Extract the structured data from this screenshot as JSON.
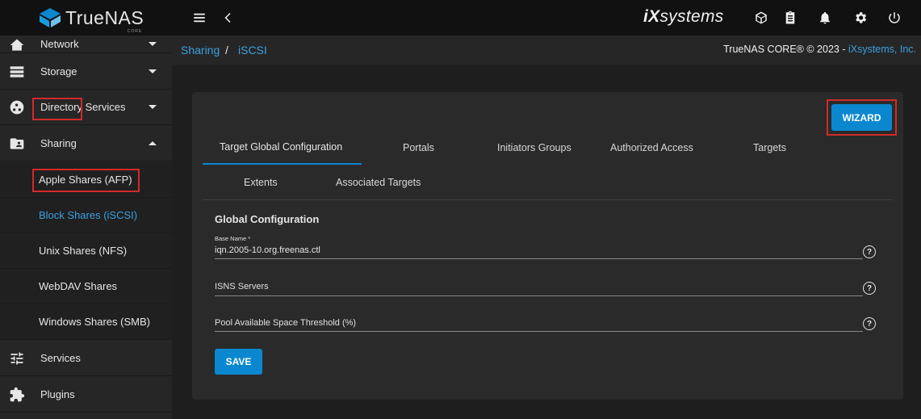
{
  "topbar": {
    "logo_text": "TrueNAS",
    "logo_sub": "CORE",
    "brand_ix": "iX",
    "brand_rest": "systems",
    "icons": [
      "menu-icon",
      "chevron-left-icon",
      "truecommand-icon",
      "clipboard-icon",
      "bell-icon",
      "gear-icon",
      "power-icon"
    ]
  },
  "sidebar": {
    "items": [
      {
        "label": "Network",
        "icon": "network-icon"
      },
      {
        "label": "Storage",
        "icon": "storage-icon"
      },
      {
        "label": "Directory Services",
        "icon": "directory-icon"
      },
      {
        "label": "Sharing",
        "icon": "folder-shared-icon"
      },
      {
        "label": "Services",
        "icon": "tune-icon"
      },
      {
        "label": "Plugins",
        "icon": "extension-icon"
      }
    ],
    "sharing_sub": [
      {
        "label": "Apple Shares (AFP)"
      },
      {
        "label": "Block Shares (iSCSI)"
      },
      {
        "label": "Unix Shares (NFS)"
      },
      {
        "label": "WebDAV Shares"
      },
      {
        "label": "Windows Shares (SMB)"
      }
    ]
  },
  "breadcrumb": {
    "parent": "Sharing",
    "separator": "/",
    "current": "iSCSI"
  },
  "copyright": {
    "text": "TrueNAS CORE® © 2023 - ",
    "link": "iXsystems, Inc."
  },
  "wizard_label": "WIZARD",
  "tabs": [
    {
      "label": "Target Global Configuration"
    },
    {
      "label": "Portals"
    },
    {
      "label": "Initiators Groups"
    },
    {
      "label": "Authorized Access"
    },
    {
      "label": "Targets"
    },
    {
      "label": "Extents"
    },
    {
      "label": "Associated Targets"
    }
  ],
  "form": {
    "title": "Global Configuration",
    "base_name_label": "Base Name *",
    "base_name_value": "iqn.2005-10.org.freenas.ctl",
    "isns_placeholder": "ISNS Servers",
    "pool_placeholder": "Pool Available Space Threshold (%)",
    "help_glyph": "?",
    "save_label": "SAVE"
  },
  "colors": {
    "accent": "#0b87d0",
    "link": "#3aa0e0",
    "highlight": "#d22a2a"
  }
}
